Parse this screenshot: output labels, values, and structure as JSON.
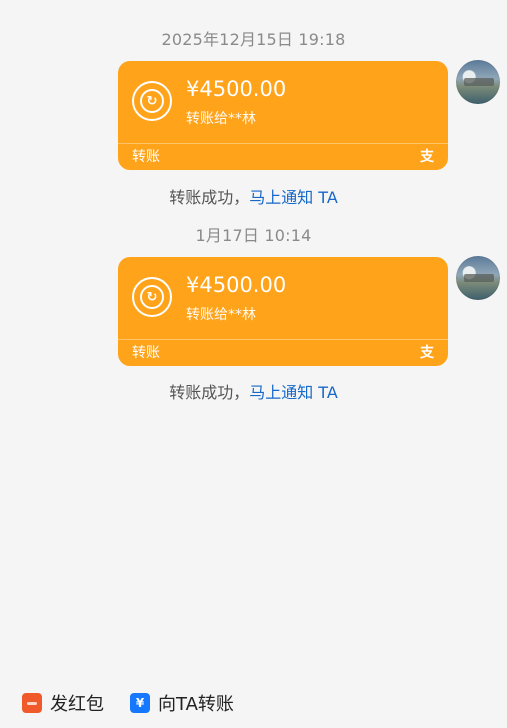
{
  "messages": [
    {
      "timestamp": "2025年12月15日 19:18",
      "amount": "¥4500.00",
      "subtitle": "转账给**林",
      "card_label": "转账",
      "notice": "转账成功，",
      "notice_link": "马上通知 TA"
    },
    {
      "timestamp": "1月17日 10:14",
      "amount": "¥4500.00",
      "subtitle": "转账给**林",
      "card_label": "转账",
      "notice": "转账成功，",
      "notice_link": "马上通知 TA"
    }
  ],
  "icons": {
    "coin_glyph": "↻",
    "alipay": "支",
    "transfer": "¥"
  },
  "bottom_bar": {
    "red_packet": "发红包",
    "transfer_to_ta": "向TA转账"
  },
  "colors": {
    "card": "#ffa31a",
    "link": "#1668c9",
    "red_packet": "#f05a2a",
    "transfer": "#1677ff"
  }
}
